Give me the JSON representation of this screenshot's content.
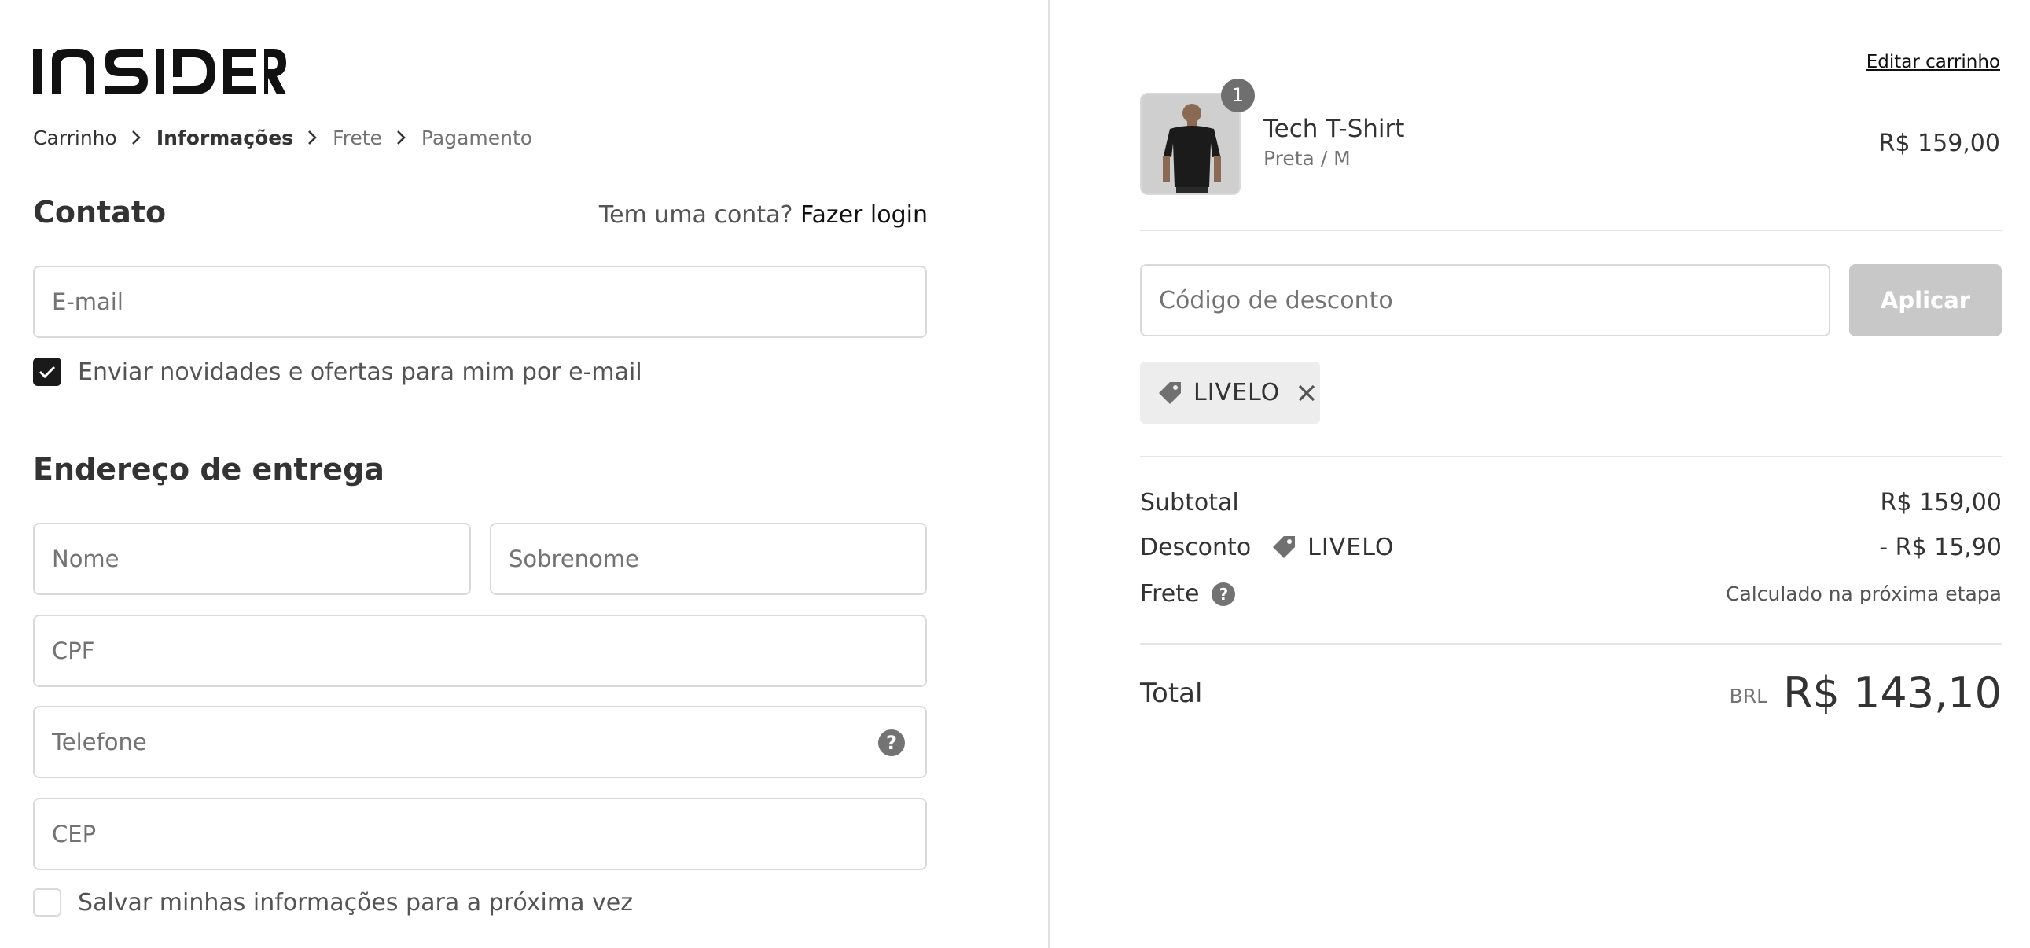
{
  "brand": {
    "logo_text": "INSIDER"
  },
  "breadcrumb": [
    {
      "label": "Carrinho",
      "state": "link"
    },
    {
      "label": "Informações",
      "state": "current"
    },
    {
      "label": "Frete",
      "state": "future"
    },
    {
      "label": "Pagamento",
      "state": "future"
    }
  ],
  "contact": {
    "title": "Contato",
    "login_prompt": "Tem uma conta?",
    "login_link": "Fazer login",
    "email_placeholder": "E-mail",
    "newsletter_label": "Enviar novidades e ofertas para mim por e-mail",
    "newsletter_checked": true
  },
  "address": {
    "title": "Endereço de entrega",
    "first_name_placeholder": "Nome",
    "last_name_placeholder": "Sobrenome",
    "cpf_placeholder": "CPF",
    "phone_placeholder": "Telefone",
    "cep_placeholder": "CEP",
    "save_info_label": "Salvar minhas informações para a próxima vez",
    "save_info_checked": false
  },
  "cart": {
    "edit_link": "Editar carrinho",
    "items": [
      {
        "name": "Tech T-Shirt",
        "variant": "Preta / M",
        "price": "R$ 159,00",
        "quantity": "1"
      }
    ],
    "discount_placeholder": "Código de desconto",
    "apply_label": "Aplicar",
    "applied_code": "LIVELO"
  },
  "summary": {
    "subtotal_label": "Subtotal",
    "subtotal_value": "R$ 159,00",
    "discount_label": "Desconto",
    "discount_code": "LIVELO",
    "discount_value": "- R$ 15,90",
    "shipping_label": "Frete",
    "shipping_value": "Calculado na próxima etapa",
    "total_label": "Total",
    "total_currency": "BRL",
    "total_value": "R$ 143,10"
  },
  "colors": {
    "accent_dark": "#1a1a1a",
    "border": "#d9d9d9",
    "muted_text": "#737373",
    "apply_disabled": "#c8c8c8"
  }
}
